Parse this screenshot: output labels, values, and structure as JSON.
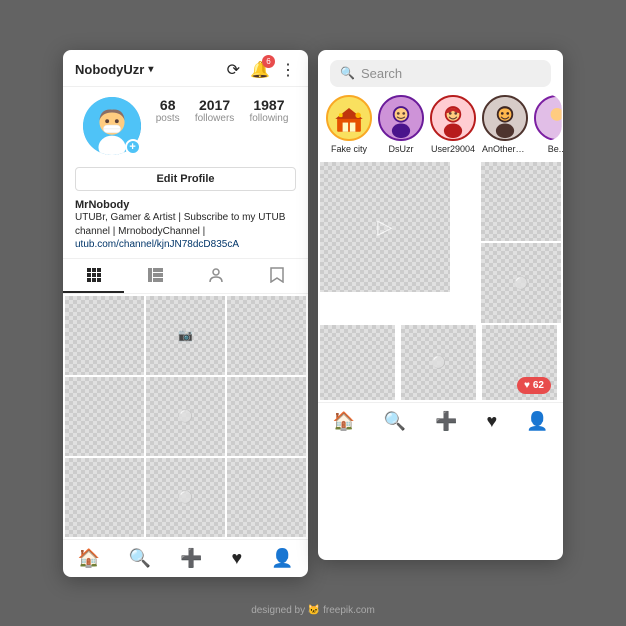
{
  "left_phone": {
    "username": "NobodyUzr",
    "dropdown_arrow": "▾",
    "notification_count": "6",
    "stats": {
      "posts": {
        "value": "68",
        "label": "posts"
      },
      "followers": {
        "value": "2017",
        "label": "followers"
      },
      "following": {
        "value": "1987",
        "label": "following"
      }
    },
    "edit_profile_label": "Edit Profile",
    "bio_name": "MrNobody",
    "bio_text": "UTUBr, Gamer & Artist | Subscribe to my UTUB channel | MrnobodyChannel |",
    "bio_link": "utub.com/channel/kjnJN78dcD835cA",
    "bottom_nav": [
      "🏠",
      "🔍",
      "➕",
      "♥",
      "👤"
    ]
  },
  "right_phone": {
    "search_placeholder": "Search",
    "stories": [
      {
        "label": "Fake city",
        "color": "#f9a825"
      },
      {
        "label": "DsUzr",
        "color": "#6a1b9a"
      },
      {
        "label": "User29004",
        "color": "#b71c1c"
      },
      {
        "label": "AnOtherYouser",
        "color": "#4e342e"
      },
      {
        "label": "Be...",
        "color": "#7b1fa2"
      }
    ],
    "like_count": "62",
    "bottom_nav": [
      "🏠",
      "🔍",
      "➕",
      "♥",
      "👤"
    ]
  },
  "watermark": "designed by 🐱 freepik.com"
}
